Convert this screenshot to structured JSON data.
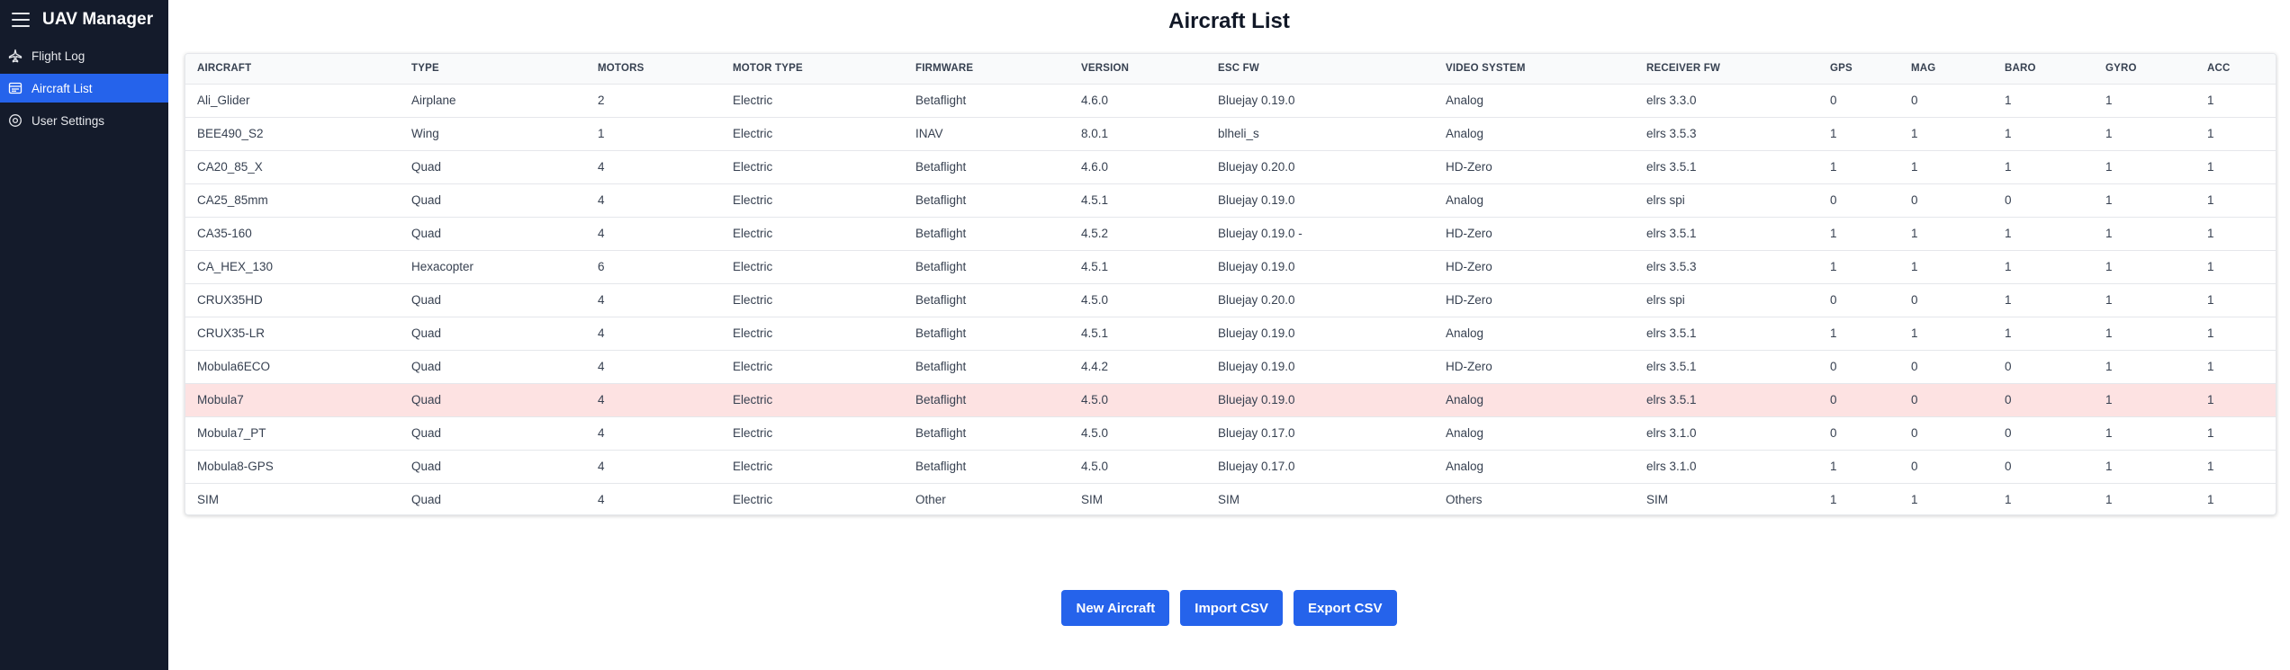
{
  "app": {
    "title": "UAV Manager"
  },
  "sidebar": {
    "items": [
      {
        "label": "Flight Log",
        "icon": "plane-icon",
        "active": false
      },
      {
        "label": "Aircraft List",
        "icon": "list-icon",
        "active": true
      },
      {
        "label": "User Settings",
        "icon": "gear-icon",
        "active": false
      }
    ]
  },
  "page": {
    "title": "Aircraft List"
  },
  "table": {
    "headers": [
      "AIRCRAFT",
      "TYPE",
      "MOTORS",
      "MOTOR TYPE",
      "FIRMWARE",
      "VERSION",
      "ESC FW",
      "VIDEO SYSTEM",
      "RECEIVER FW",
      "GPS",
      "MAG",
      "BARO",
      "GYRO",
      "ACC"
    ],
    "rows": [
      [
        "Ali_Glider",
        "Airplane",
        "2",
        "Electric",
        "Betaflight",
        "4.6.0",
        "Bluejay 0.19.0",
        "Analog",
        "elrs 3.3.0",
        "0",
        "0",
        "1",
        "1",
        "1"
      ],
      [
        "BEE490_S2",
        "Wing",
        "1",
        "Electric",
        "INAV",
        "8.0.1",
        "blheli_s",
        "Analog",
        "elrs 3.5.3",
        "1",
        "1",
        "1",
        "1",
        "1"
      ],
      [
        "CA20_85_X",
        "Quad",
        "4",
        "Electric",
        "Betaflight",
        "4.6.0",
        "Bluejay 0.20.0",
        "HD-Zero",
        "elrs 3.5.1",
        "1",
        "1",
        "1",
        "1",
        "1"
      ],
      [
        "CA25_85mm",
        "Quad",
        "4",
        "Electric",
        "Betaflight",
        "4.5.1",
        "Bluejay 0.19.0",
        "Analog",
        "elrs spi",
        "0",
        "0",
        "0",
        "1",
        "1"
      ],
      [
        "CA35-160",
        "Quad",
        "4",
        "Electric",
        "Betaflight",
        "4.5.2",
        "Bluejay 0.19.0 -",
        "HD-Zero",
        "elrs 3.5.1",
        "1",
        "1",
        "1",
        "1",
        "1"
      ],
      [
        "CA_HEX_130",
        "Hexacopter",
        "6",
        "Electric",
        "Betaflight",
        "4.5.1",
        "Bluejay 0.19.0",
        "HD-Zero",
        "elrs 3.5.3",
        "1",
        "1",
        "1",
        "1",
        "1"
      ],
      [
        "CRUX35HD",
        "Quad",
        "4",
        "Electric",
        "Betaflight",
        "4.5.0",
        "Bluejay 0.20.0",
        "HD-Zero",
        "elrs spi",
        "0",
        "0",
        "1",
        "1",
        "1"
      ],
      [
        "CRUX35-LR",
        "Quad",
        "4",
        "Electric",
        "Betaflight",
        "4.5.1",
        "Bluejay 0.19.0",
        "Analog",
        "elrs 3.5.1",
        "1",
        "1",
        "1",
        "1",
        "1"
      ],
      [
        "Mobula6ECO",
        "Quad",
        "4",
        "Electric",
        "Betaflight",
        "4.4.2",
        "Bluejay 0.19.0",
        "HD-Zero",
        "elrs 3.5.1",
        "0",
        "0",
        "0",
        "1",
        "1"
      ],
      [
        "Mobula7",
        "Quad",
        "4",
        "Electric",
        "Betaflight",
        "4.5.0",
        "Bluejay 0.19.0",
        "Analog",
        "elrs 3.5.1",
        "0",
        "0",
        "0",
        "1",
        "1"
      ],
      [
        "Mobula7_PT",
        "Quad",
        "4",
        "Electric",
        "Betaflight",
        "4.5.0",
        "Bluejay 0.17.0",
        "Analog",
        "elrs 3.1.0",
        "0",
        "0",
        "0",
        "1",
        "1"
      ],
      [
        "Mobula8-GPS",
        "Quad",
        "4",
        "Electric",
        "Betaflight",
        "4.5.0",
        "Bluejay 0.17.0",
        "Analog",
        "elrs 3.1.0",
        "1",
        "0",
        "0",
        "1",
        "1"
      ],
      [
        "SIM",
        "Quad",
        "4",
        "Electric",
        "Other",
        "SIM",
        "SIM",
        "Others",
        "SIM",
        "1",
        "1",
        "1",
        "1",
        "1"
      ]
    ],
    "highlighted_row": "Mobula7"
  },
  "actions": {
    "new_label": "New Aircraft",
    "import_label": "Import CSV",
    "export_label": "Export CSV"
  },
  "colors": {
    "sidebar_bg": "#141b2b",
    "accent": "#2563eb",
    "highlight_row": "#fde2e2"
  }
}
